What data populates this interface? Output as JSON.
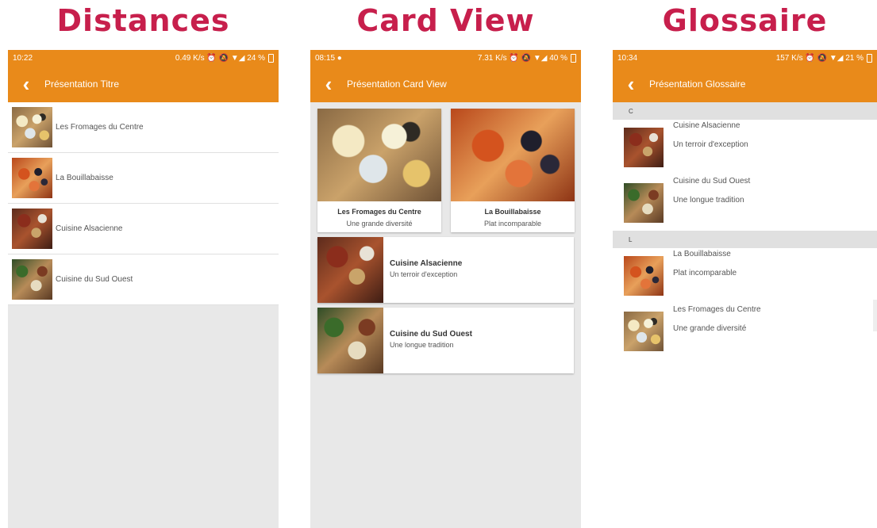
{
  "headings": [
    "Distances",
    "Card View",
    "Glossaire"
  ],
  "colors": {
    "accent": "#e98a1a",
    "heading": "#c71f4c"
  },
  "phones": [
    {
      "status": {
        "time": "10:22",
        "right": "0.49 K/s ⏰ 🔕 ▼◢ 24 %"
      },
      "appbar_title": "Présentation Titre",
      "back_icon": "chevron-left-icon",
      "items": [
        {
          "title": "Les Fromages du Centre",
          "image": "cheese-photo"
        },
        {
          "title": "La Bouillabaisse",
          "image": "bouillabaisse-photo"
        },
        {
          "title": "Cuisine Alsacienne",
          "image": "alsace-photo"
        },
        {
          "title": "Cuisine du Sud Ouest",
          "image": "sudouest-photo"
        }
      ]
    },
    {
      "status": {
        "time": "08:15 ●",
        "right": "7.31 K/s ⏰ 🔕 ▼◢ 40 %"
      },
      "appbar_title": "Présentation Card View",
      "back_icon": "chevron-left-icon",
      "grid_cards": [
        {
          "title": "Les Fromages du Centre",
          "subtitle": "Une grande diversité",
          "image": "cheese-photo"
        },
        {
          "title": "La Bouillabaisse",
          "subtitle": "Plat incomparable",
          "image": "bouillabaisse-photo"
        }
      ],
      "wide_cards": [
        {
          "title": "Cuisine Alsacienne",
          "subtitle": "Un terroir d'exception",
          "image": "alsace-photo"
        },
        {
          "title": "Cuisine du Sud Ouest",
          "subtitle": "Une longue tradition",
          "image": "sudouest-photo"
        }
      ]
    },
    {
      "status": {
        "time": "10:34",
        "right": "157 K/s ⏰ 🔕 ▼◢ 21 %"
      },
      "appbar_title": "Présentation Glossaire",
      "back_icon": "chevron-left-icon",
      "sections": [
        {
          "letter": "C",
          "items": [
            {
              "title": "Cuisine Alsacienne",
              "subtitle": "Un terroir d'exception",
              "image": "alsace-photo"
            },
            {
              "title": "Cuisine du Sud Ouest",
              "subtitle": "Une longue tradition",
              "image": "sudouest-photo"
            }
          ]
        },
        {
          "letter": "L",
          "items": [
            {
              "title": "La Bouillabaisse",
              "subtitle": "Plat incomparable",
              "image": "bouillabaisse-photo"
            },
            {
              "title": "Les Fromages du Centre",
              "subtitle": "Une grande diversité",
              "image": "cheese-photo"
            }
          ]
        }
      ]
    }
  ]
}
